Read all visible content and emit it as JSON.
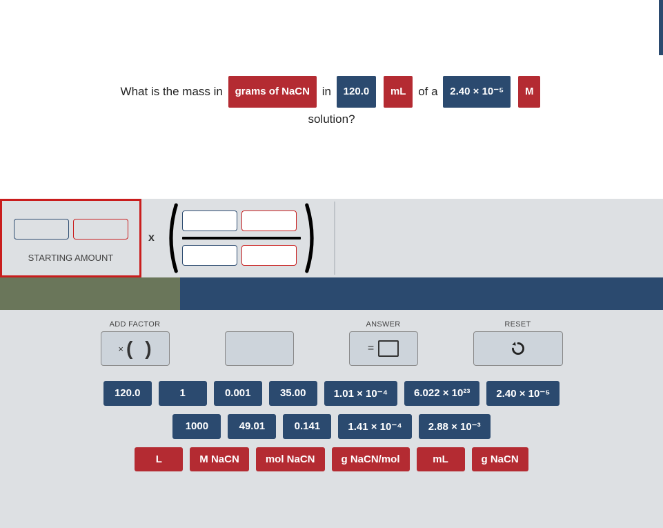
{
  "question": {
    "p1": "What is the mass in",
    "chip_grams": "grams of NaCN",
    "p2": "in",
    "chip_volume_value": "120.0",
    "chip_volume_unit": "mL",
    "p3": "of a",
    "chip_conc_value": "2.40 × 10⁻⁵",
    "chip_conc_unit": "M",
    "p4": "solution?"
  },
  "starting_amount_label": "STARTING AMOUNT",
  "multiply_symbol": "x",
  "controls": {
    "add_factor_label": "ADD FACTOR",
    "add_factor_display": "×  (    )",
    "answer_label": "ANSWER",
    "answer_eq": "=",
    "reset_label": "RESET"
  },
  "value_tiles_row1": [
    "120.0",
    "1",
    "0.001",
    "35.00",
    "1.01 × 10⁻⁴",
    "6.022 × 10²³",
    "2.40 × 10⁻⁵"
  ],
  "value_tiles_row2": [
    "1000",
    "49.01",
    "0.141",
    "1.41 × 10⁻⁴",
    "2.88 × 10⁻³"
  ],
  "unit_tiles": [
    "L",
    "M NaCN",
    "mol NaCN",
    "g NaCN/mol",
    "mL",
    "g NaCN"
  ]
}
